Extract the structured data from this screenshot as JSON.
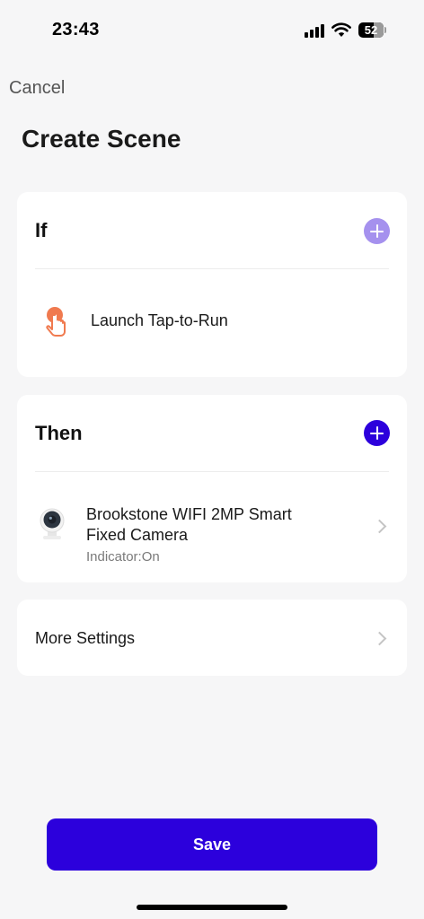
{
  "status_bar": {
    "time": "23:43",
    "battery": "52",
    "icons": [
      "signal-icon",
      "wifi-icon",
      "battery-icon"
    ]
  },
  "header": {
    "cancel_label": "Cancel",
    "title": "Create Scene"
  },
  "if_section": {
    "title": "If",
    "add_icon": "plus-circle-icon",
    "add_color": "#a591ee",
    "item": {
      "icon": "tap-hand-icon",
      "icon_color": "#f07a4f",
      "label": "Launch Tap-to-Run"
    }
  },
  "then_section": {
    "title": "Then",
    "add_icon": "plus-circle-icon",
    "add_color": "#2c00dc",
    "item": {
      "icon": "camera-icon",
      "label_line1": "Brookstone WIFI 2MP Smart",
      "label_line2": "Fixed Camera",
      "sub": "Indicator:On"
    }
  },
  "more_settings": {
    "label": "More Settings"
  },
  "save_label": "Save",
  "colors": {
    "accent": "#2c00dc",
    "background": "#f6f6f7",
    "card": "#ffffff"
  }
}
